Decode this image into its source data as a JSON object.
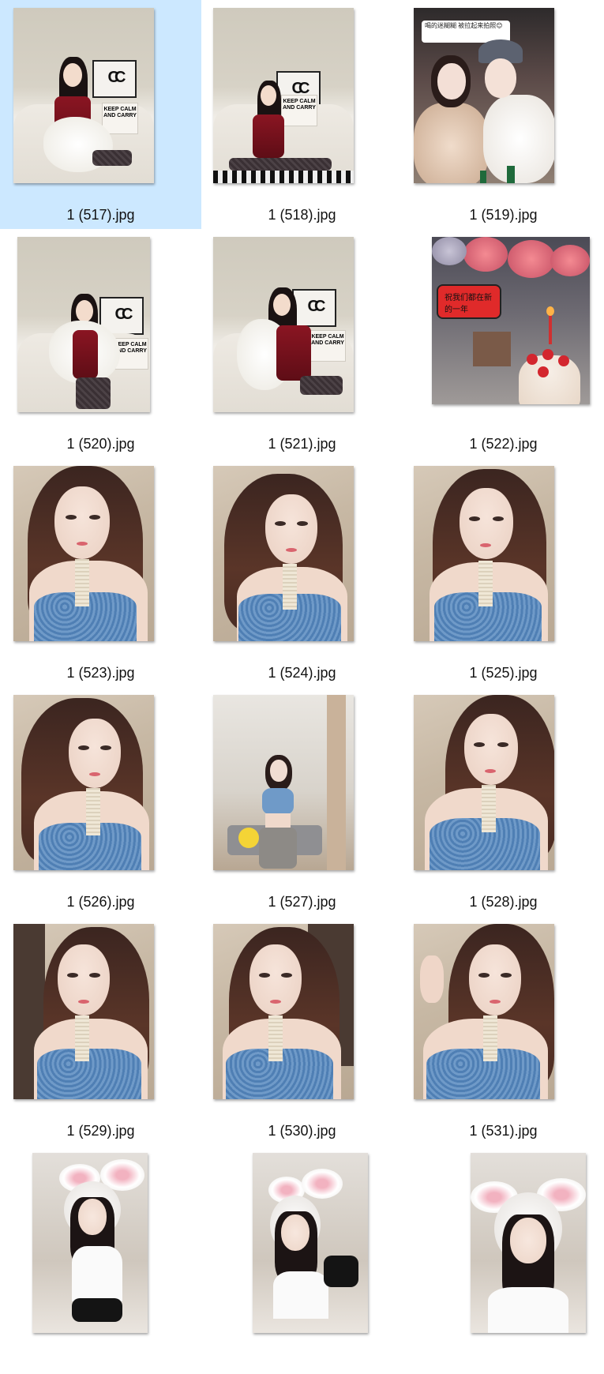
{
  "files": [
    {
      "name": "1 (517).jpg",
      "selected": true
    },
    {
      "name": "1 (518).jpg"
    },
    {
      "name": "1 (519).jpg"
    },
    {
      "name": "1 (520).jpg"
    },
    {
      "name": "1 (521).jpg"
    },
    {
      "name": "1 (522).jpg"
    },
    {
      "name": "1 (523).jpg"
    },
    {
      "name": "1 (524).jpg"
    },
    {
      "name": "1 (525).jpg"
    },
    {
      "name": "1 (526).jpg"
    },
    {
      "name": "1 (527).jpg"
    },
    {
      "name": "1 (528).jpg"
    },
    {
      "name": "1 (529).jpg"
    },
    {
      "name": "1 (530).jpg"
    },
    {
      "name": "1 (531).jpg"
    },
    {
      "name": ""
    },
    {
      "name": ""
    },
    {
      "name": ""
    }
  ],
  "photo_text": {
    "bubble_519": "喝的迷糊糊 被拉起来拍照😊",
    "phone_522": "祝我们都在新的一年",
    "pillow": "KEEP CALM AND CARRY"
  },
  "colors": {
    "selection": "#cce8ff",
    "background": "#ffffff"
  }
}
